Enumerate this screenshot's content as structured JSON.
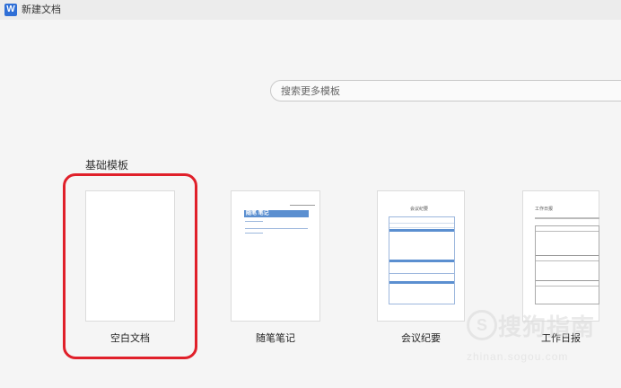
{
  "window": {
    "title": "新建文档",
    "app_icon": "W"
  },
  "search": {
    "placeholder": "搜索更多模板"
  },
  "section": {
    "title": "基础模板"
  },
  "templates": [
    {
      "label": "空白文档"
    },
    {
      "label": "随笔笔记",
      "heading": "随笔 笔记"
    },
    {
      "label": "会议纪要",
      "heading": "会议纪要"
    },
    {
      "label": "工作日报",
      "heading": "工作日报"
    }
  ],
  "watermark": {
    "text": "搜狗指南",
    "url": "zhinan.sogou.com"
  },
  "colors": {
    "highlight": "#e0202a",
    "accent": "#5b8fd0"
  }
}
